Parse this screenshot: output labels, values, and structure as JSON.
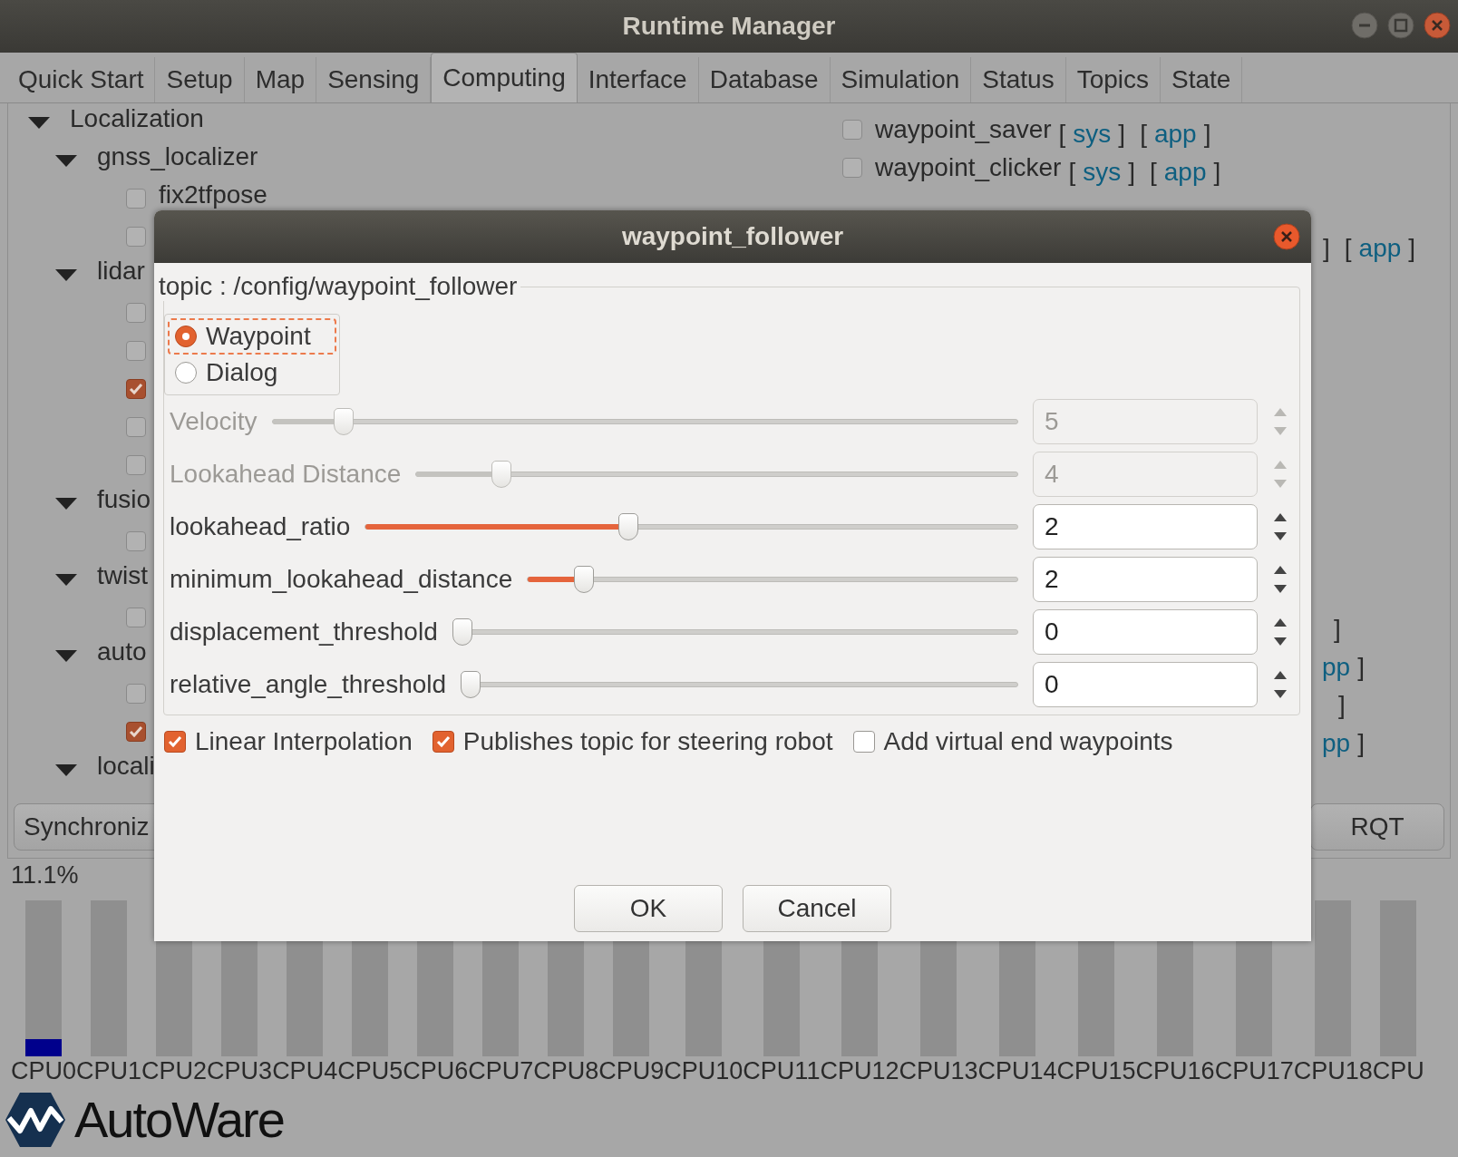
{
  "window": {
    "title": "Runtime Manager"
  },
  "tabs": [
    {
      "label": "Quick Start",
      "selected": false
    },
    {
      "label": "Setup",
      "selected": false
    },
    {
      "label": "Map",
      "selected": false
    },
    {
      "label": "Sensing",
      "selected": false
    },
    {
      "label": "Computing",
      "selected": true
    },
    {
      "label": "Interface",
      "selected": false
    },
    {
      "label": "Database",
      "selected": false
    },
    {
      "label": "Simulation",
      "selected": false
    },
    {
      "label": "Status",
      "selected": false
    },
    {
      "label": "Topics",
      "selected": false
    },
    {
      "label": "State",
      "selected": false
    }
  ],
  "tree": [
    {
      "kind": "group",
      "label": "Localization",
      "expanded": true,
      "children": [
        {
          "kind": "group",
          "label": "gnss_localizer",
          "expanded": true,
          "children": [
            {
              "kind": "node",
              "label": "fix2tfpose",
              "checked": false
            },
            {
              "kind": "node",
              "checked": false
            }
          ]
        },
        {
          "kind": "group",
          "label": "lidar",
          "expanded": true,
          "children": [
            {
              "kind": "node",
              "checked": false
            },
            {
              "kind": "node",
              "checked": false
            },
            {
              "kind": "node",
              "checked": true
            },
            {
              "kind": "node",
              "checked": false
            },
            {
              "kind": "node",
              "checked": false
            }
          ]
        },
        {
          "kind": "group",
          "label": "fusio",
          "expanded": true,
          "children": [
            {
              "kind": "node",
              "checked": false
            }
          ]
        },
        {
          "kind": "group",
          "label": "twist",
          "expanded": true,
          "children": [
            {
              "kind": "node",
              "checked": false
            }
          ]
        },
        {
          "kind": "group",
          "label": "auto",
          "expanded": true,
          "children": [
            {
              "kind": "node",
              "checked": false
            },
            {
              "kind": "node",
              "checked": true
            }
          ]
        },
        {
          "kind": "group",
          "label": "locali",
          "expanded": true
        }
      ]
    }
  ],
  "right_list": [
    {
      "kind": "node",
      "label": "waypoint_saver",
      "checked": false,
      "parts": [
        {
          "kind": "bracket",
          "text": "["
        },
        {
          "kind": "link",
          "text": "sys"
        },
        {
          "kind": "bracket",
          "text": "]"
        },
        {
          "kind": "bracket",
          "text": "["
        },
        {
          "kind": "link",
          "text": "app"
        },
        {
          "kind": "bracket",
          "text": "]"
        }
      ]
    },
    {
      "kind": "node",
      "label": "waypoint_clicker",
      "checked": false,
      "parts": [
        {
          "kind": "bracket",
          "text": "["
        },
        {
          "kind": "link",
          "text": "sys"
        },
        {
          "kind": "bracket",
          "text": "]"
        },
        {
          "kind": "bracket",
          "text": "["
        },
        {
          "kind": "link",
          "text": "app"
        },
        {
          "kind": "bracket",
          "text": "]"
        }
      ]
    },
    {
      "kind": "tail",
      "parts": [
        {
          "kind": "bracket",
          "text": "]"
        },
        {
          "kind": "bracket",
          "text": "["
        },
        {
          "kind": "link",
          "text": "app"
        },
        {
          "kind": "bracket",
          "text": "]"
        }
      ]
    },
    {
      "kind": "tail",
      "parts": [
        {
          "kind": "bracket",
          "text": "]"
        }
      ]
    },
    {
      "kind": "tail",
      "parts": [
        {
          "kind": "link",
          "text": "pp"
        },
        {
          "kind": "bracket",
          "text": "]"
        }
      ]
    },
    {
      "kind": "tail",
      "parts": [
        {
          "kind": "bracket",
          "text": "]"
        }
      ]
    },
    {
      "kind": "tail",
      "parts": [
        {
          "kind": "link",
          "text": "pp"
        },
        {
          "kind": "bracket",
          "text": "]"
        }
      ]
    }
  ],
  "bottom_buttons": [
    "Synchroniz",
    "RQT"
  ],
  "cpu_usage": "11.1%",
  "cpus": [
    {
      "label": "CPU0",
      "level": 0.11
    },
    {
      "label": "CPU1"
    },
    {
      "label": "CPU2"
    },
    {
      "label": "CPU3"
    },
    {
      "label": "CPU4"
    },
    {
      "label": "CPU5"
    },
    {
      "label": "CPU6"
    },
    {
      "label": "CPU7"
    },
    {
      "label": "CPU8"
    },
    {
      "label": "CPU9"
    },
    {
      "label": "CPU10"
    },
    {
      "label": "CPU11"
    },
    {
      "label": "CPU12"
    },
    {
      "label": "CPU13"
    },
    {
      "label": "CPU14"
    },
    {
      "label": "CPU15"
    },
    {
      "label": "CPU16"
    },
    {
      "label": "CPU17"
    },
    {
      "label": "CPU18"
    },
    {
      "label": "CPU"
    }
  ],
  "logo": "AutoWare",
  "dialog": {
    "title": "waypoint_follower",
    "topic": "topic : /config/waypoint_follower",
    "modes": [
      {
        "label": "Waypoint",
        "selected": true,
        "focused": true
      },
      {
        "label": "Dialog",
        "selected": false,
        "focused": false
      }
    ],
    "params": [
      {
        "label": "Velocity",
        "disabled": true,
        "level": 0.085,
        "value": "5"
      },
      {
        "label": "Lookahead Distance",
        "disabled": true,
        "level": 0.13,
        "value": "4"
      },
      {
        "label": "lookahead_ratio",
        "disabled": false,
        "level": 0.4,
        "value": "2"
      },
      {
        "label": "minimum_lookahead_distance",
        "disabled": false,
        "level": 0.1,
        "value": "2"
      },
      {
        "label": "displacement_threshold",
        "disabled": false,
        "level": 0,
        "value": "0"
      },
      {
        "label": "relative_angle_threshold",
        "disabled": false,
        "level": 0,
        "value": "0"
      }
    ],
    "options": [
      {
        "label": "Linear Interpolation",
        "checked": true
      },
      {
        "label": "Publishes topic for steering robot",
        "checked": true
      },
      {
        "label": "Add virtual end waypoints",
        "checked": false
      }
    ],
    "buttons": [
      "OK",
      "Cancel"
    ]
  }
}
